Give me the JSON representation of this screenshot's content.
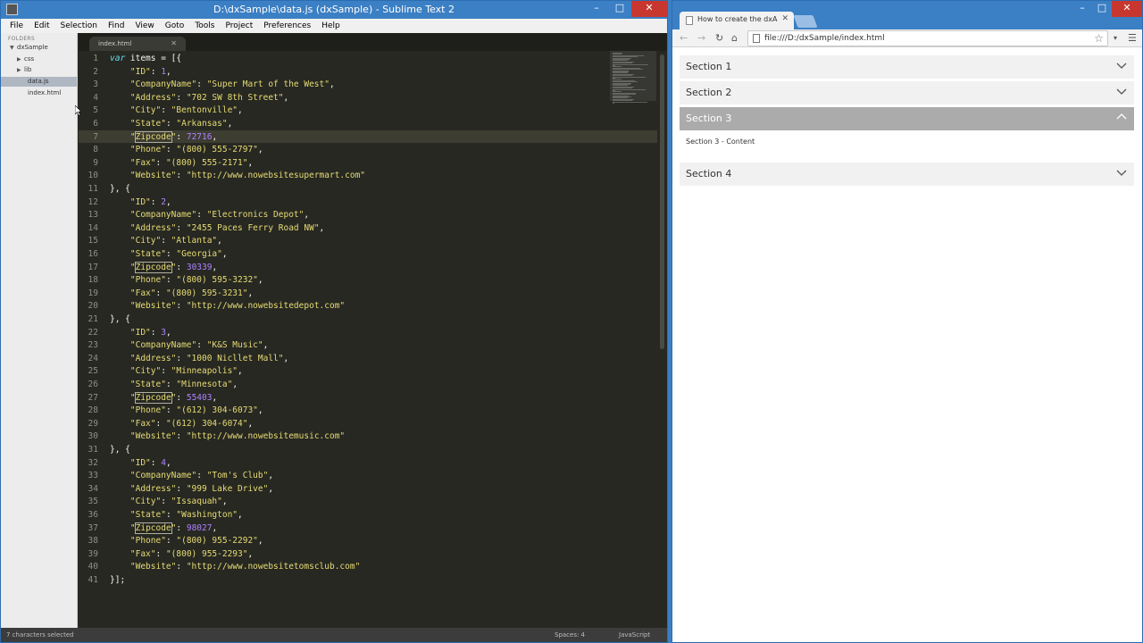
{
  "sublime": {
    "title": "D:\\dxSample\\data.js (dxSample) - Sublime Text 2",
    "menu": [
      "File",
      "Edit",
      "Selection",
      "Find",
      "View",
      "Goto",
      "Tools",
      "Project",
      "Preferences",
      "Help"
    ],
    "sidebar": {
      "header": "FOLDERS",
      "root": "dxSample",
      "folders": [
        "css",
        "lib"
      ],
      "files": [
        "data.js",
        "index.html"
      ]
    },
    "tab": {
      "label": "index.html"
    },
    "status": {
      "left": "7 characters selected",
      "spaces": "Spaces: 4",
      "syntax": "JavaScript"
    },
    "editor": {
      "highlighted_line": 7
    }
  },
  "chrome": {
    "tab_title": "How to create the dxA",
    "url": "file:///D:/dxSample/index.html",
    "accordion": {
      "sections": [
        {
          "title": "Section 1",
          "expanded": false
        },
        {
          "title": "Section 2",
          "expanded": false
        },
        {
          "title": "Section 3",
          "expanded": true
        },
        {
          "title": "Section 4",
          "expanded": false
        }
      ],
      "content": "Section 3 - Content"
    }
  },
  "colors": {
    "keyword": "#66d9ef",
    "string": "#e6db74",
    "number": "#ae81ff",
    "editor_bg": "#272822",
    "accordion_active": "#ababab"
  },
  "icons": [
    "back-icon",
    "forward-icon",
    "reload-icon",
    "home-icon",
    "star-icon",
    "menu-icon",
    "chevron-down-icon",
    "chevron-up-icon"
  ]
}
